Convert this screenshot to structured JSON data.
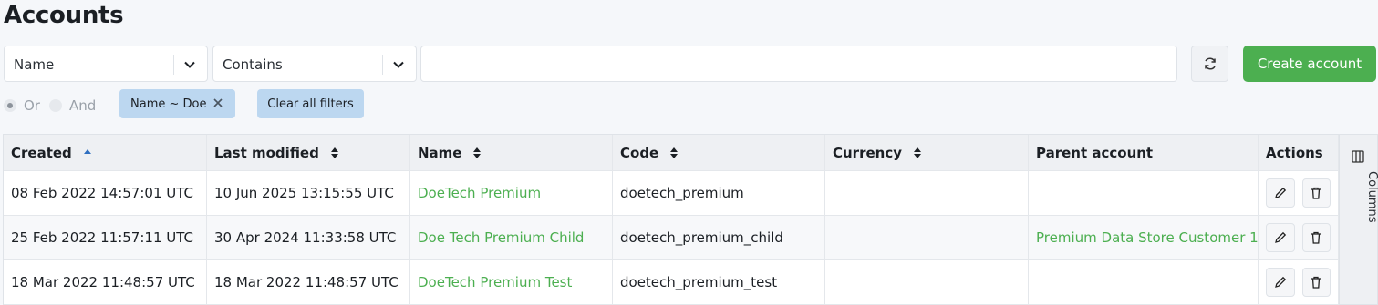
{
  "page": {
    "title": "Accounts"
  },
  "filter": {
    "field": "Name",
    "operator": "Contains",
    "search_value": "",
    "create_label": "Create account",
    "logic": {
      "or": "Or",
      "and": "And",
      "selected": "Or"
    },
    "chips": [
      {
        "label": "Name ~ Doe"
      }
    ],
    "clear_label": "Clear all filters"
  },
  "table": {
    "columns": [
      "Created",
      "Last modified",
      "Name",
      "Code",
      "Currency",
      "Parent account",
      "Actions"
    ],
    "rows": [
      {
        "created": "08 Feb 2022 14:57:01 UTC",
        "modified": "10 Jun 2025 13:15:55 UTC",
        "name": "DoeTech Premium",
        "code": "doetech_premium",
        "currency": "",
        "parent": ""
      },
      {
        "created": "25 Feb 2022 11:57:11 UTC",
        "modified": "30 Apr 2024 11:33:58 UTC",
        "name": "Doe Tech Premium Child",
        "code": "doetech_premium_child",
        "currency": "",
        "parent": "Premium Data Store Customer 1"
      },
      {
        "created": "18 Mar 2022 11:48:57 UTC",
        "modified": "18 Mar 2022 11:48:57 UTC",
        "name": "DoeTech Premium Test",
        "code": "doetech_premium_test",
        "currency": "",
        "parent": ""
      }
    ],
    "side_panel": "Columns"
  },
  "colors": {
    "accent": "#4caf50",
    "chip": "#bcd7f0",
    "header_bg": "#eef0f3"
  }
}
